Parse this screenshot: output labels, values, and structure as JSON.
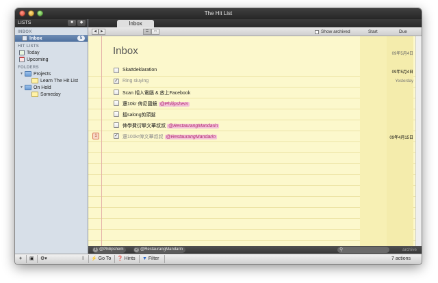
{
  "window": {
    "title": "The Hit List"
  },
  "sidebar": {
    "header_label": "LISTS",
    "sections": {
      "inbox_label": "INBOX",
      "hitlists_label": "HIT LISTS",
      "folders_label": "FOLDERS"
    },
    "inbox": {
      "label": "Inbox",
      "count": "5"
    },
    "hitlists": [
      {
        "label": "Today"
      },
      {
        "label": "Upcoming"
      }
    ],
    "folders": {
      "projects": {
        "label": "Projects",
        "children": [
          {
            "label": "Learn The Hit List"
          }
        ]
      },
      "onhold": {
        "label": "On Hold",
        "children": [
          {
            "label": "Someday"
          }
        ]
      }
    }
  },
  "main": {
    "tab_label": "Inbox",
    "toolbar": {
      "show_archived": "Show archived",
      "col_start": "Start",
      "col_due": "Due"
    },
    "heading": "Inbox",
    "heading_due": "09年5月4日",
    "tasks": [
      {
        "text": "Skattdeklaration",
        "context": "",
        "done": false,
        "due": "09年5月4日",
        "priority": ""
      },
      {
        "text": "Ring siuying",
        "context": "",
        "done": true,
        "due": "Yesterday",
        "priority": ""
      },
      {
        "text": "Scan 相入電腦 & 放上Facebook",
        "context": "",
        "done": false,
        "due": "",
        "priority": ""
      },
      {
        "text": "還10kr 俾尼國鏡",
        "context": "@Philipshem",
        "done": false,
        "due": "",
        "priority": ""
      },
      {
        "text": "搵salong剪頭髮",
        "context": "",
        "done": false,
        "due": "",
        "priority": ""
      },
      {
        "text": "俾學費衍擊文華叔叔",
        "context": "@RestaurangMandarin",
        "done": false,
        "due": "",
        "priority": ""
      },
      {
        "text": "還100kr俾文華叔叔",
        "context": "@RestaurangMandarin",
        "done": true,
        "due": "09年4月15日",
        "priority": "1"
      }
    ],
    "tagbar": {
      "tags": [
        {
          "num": "1",
          "label": "@Philipshem"
        },
        {
          "num": "2",
          "label": "@RestaurangMandarin"
        }
      ],
      "archive_label": "archive"
    }
  },
  "bottombar": {
    "add": "+",
    "goto": "Go To",
    "hints": "Hints",
    "filter": "Filter",
    "actions_count": "7 actions"
  },
  "colors": {
    "selection": "#4d6f9e",
    "pad": "#fcf8cc",
    "context_tag": "#f4c2d9"
  }
}
